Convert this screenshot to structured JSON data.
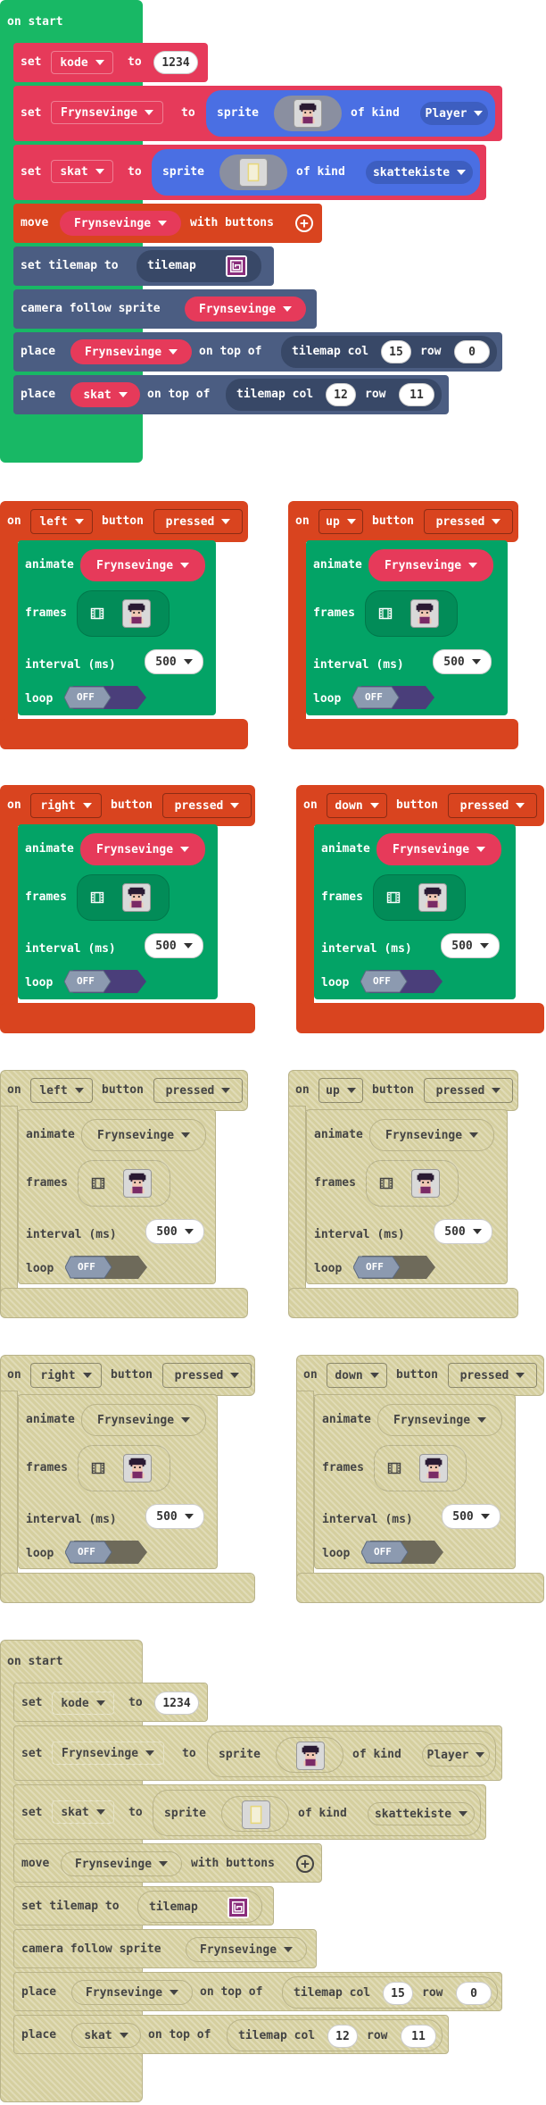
{
  "start_block": {
    "header": "on start",
    "set_kode": {
      "set": "set",
      "var": "kode",
      "to": "to",
      "value": "1234"
    },
    "set_fryns": {
      "set": "set",
      "var": "Frynsevinge",
      "to": "to",
      "sprite": "sprite",
      "of_kind": "of kind",
      "kind": "Player"
    },
    "set_skat": {
      "set": "set",
      "var": "skat",
      "to": "to",
      "sprite": "sprite",
      "of_kind": "of kind",
      "kind": "skattekiste"
    },
    "move": {
      "move": "move",
      "var": "Frynsevinge",
      "with_buttons": "with buttons"
    },
    "tilemap": {
      "label": "set tilemap to",
      "tilemap": "tilemap"
    },
    "camera": {
      "label": "camera follow sprite",
      "var": "Frynsevinge"
    },
    "place1": {
      "place": "place",
      "var": "Frynsevinge",
      "on_top_of": "on top of",
      "tilemap_col": "tilemap col",
      "col": "15",
      "row_label": "row",
      "row": "0"
    },
    "place2": {
      "place": "place",
      "var": "skat",
      "on_top_of": "on top of",
      "tilemap_col": "tilemap col",
      "col": "12",
      "row_label": "row",
      "row": "11"
    }
  },
  "button_events": [
    {
      "on": "on",
      "button": "left",
      "button_label": "button",
      "event": "pressed",
      "animate": "animate",
      "sprite": "Frynsevinge",
      "frames": "frames",
      "interval_label": "interval (ms)",
      "interval": "500",
      "loop": "loop",
      "loop_state": "OFF"
    },
    {
      "on": "on",
      "button": "up",
      "button_label": "button",
      "event": "pressed",
      "animate": "animate",
      "sprite": "Frynsevinge",
      "frames": "frames",
      "interval_label": "interval (ms)",
      "interval": "500",
      "loop": "loop",
      "loop_state": "OFF"
    },
    {
      "on": "on",
      "button": "right",
      "button_label": "button",
      "event": "pressed",
      "animate": "animate",
      "sprite": "Frynsevinge",
      "frames": "frames",
      "interval_label": "interval (ms)",
      "interval": "500",
      "loop": "loop",
      "loop_state": "OFF"
    },
    {
      "on": "on",
      "button": "down",
      "button_label": "button",
      "event": "pressed",
      "animate": "animate",
      "sprite": "Frynsevinge",
      "frames": "frames",
      "interval_label": "interval (ms)",
      "interval": "500",
      "loop": "loop",
      "loop_state": "OFF"
    }
  ],
  "colors": {
    "events_green": "#18b865",
    "variables_red": "#e63a5a",
    "sprites_blue": "#4a6fe3",
    "controller_orange": "#d9441f",
    "scene_slate": "#4b5d82",
    "animation_green": "#03a366",
    "disabled_tan": "#d5cf9f"
  },
  "icons": {
    "plus": "plus-circle-icon",
    "film": "film-icon",
    "tilemap": "tilemap-icon",
    "dropdown": "chevron-down-icon"
  }
}
